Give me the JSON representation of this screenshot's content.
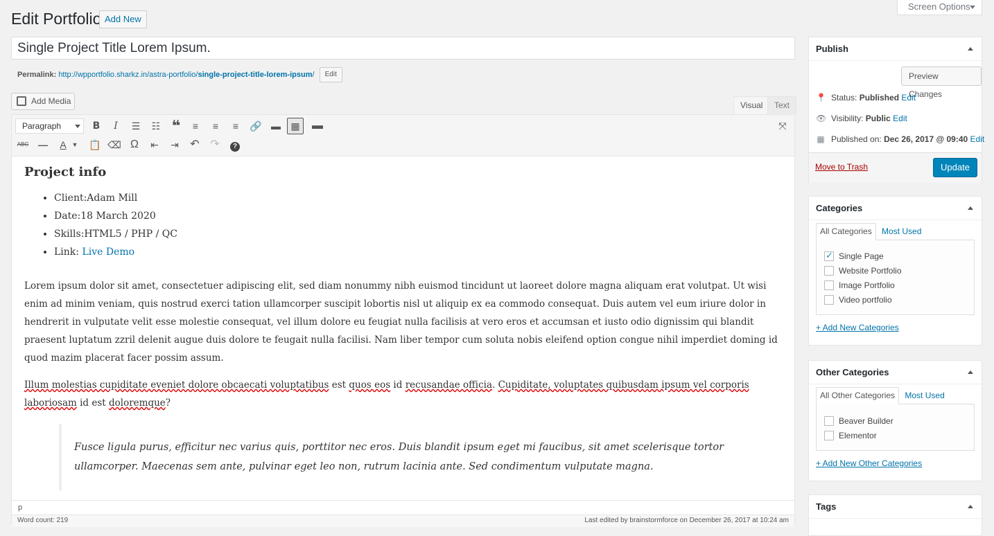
{
  "header": {
    "title": "Edit Portfolio",
    "add_new": "Add New",
    "screen_options": "Screen Options"
  },
  "post": {
    "title": "Single Project Title Lorem Ipsum.",
    "permalink_label": "Permalink:",
    "permalink_base": "http://wpportfolio.sharkz.in/astra-portfolio/",
    "permalink_slug": "single-project-title-lorem-ipsum",
    "permalink_end": "/",
    "permalink_edit": "Edit"
  },
  "editor": {
    "add_media": "Add Media",
    "tab_visual": "Visual",
    "tab_text": "Text",
    "format_select": "Paragraph",
    "path": "p",
    "word_count": "Word count: 219",
    "last_edited": "Last edited by brainstormforce on December 26, 2017 at 10:24 am",
    "toolbar_icons": [
      "bold-icon",
      "italic-icon",
      "bullet-list-icon",
      "numbered-list-icon",
      "blockquote-icon",
      "align-left-icon",
      "align-center-icon",
      "align-right-icon",
      "link-icon",
      "read-more-icon",
      "toolbar-toggle-icon",
      "more-icon",
      "fullscreen-icon",
      "strikethrough-icon",
      "horizontal-line-icon",
      "text-color-icon",
      "paste-text-icon",
      "clear-formatting-icon",
      "special-character-icon",
      "outdent-icon",
      "indent-icon",
      "undo-icon",
      "redo-icon",
      "help-icon"
    ]
  },
  "content": {
    "heading": "Project info",
    "items": [
      "Client:Adam Mill",
      "Date:18 March 2020",
      "Skills:HTML5 / PHP / QC"
    ],
    "link_label": "Link: ",
    "link_text": "Live Demo",
    "paragraph1": "Lorem ipsum dolor sit amet, consectetuer adipiscing elit, sed diam nonummy nibh euismod tincidunt ut laoreet dolore magna aliquam erat volutpat. Ut wisi enim ad minim veniam, quis nostrud exerci tation ullamcorper suscipit lobortis nisl ut aliquip ex ea commodo consequat. Duis autem vel eum iriure dolor in hendrerit in vulputate velit esse molestie consequat, vel illum dolore eu feugiat nulla facilisis at vero eros et accumsan et iusto odio dignissim qui blandit praesent luptatum zzril delenit augue duis dolore te feugait nulla facilisi. Nam liber tempor cum soluta nobis eleifend option congue nihil imperdiet doming id quod mazim placerat facer possim assum.",
    "paragraph2_parts": [
      {
        "t": "Illum molestias cupiditate eveniet dolore obcaecati voluptatibus",
        "sq": true
      },
      {
        "t": " est ",
        "sq": false
      },
      {
        "t": "quos eos",
        "sq": true
      },
      {
        "t": " id ",
        "sq": false
      },
      {
        "t": "recusandae officia",
        "sq": true
      },
      {
        "t": ". ",
        "sq": false
      },
      {
        "t": "Cupiditate, voluptates quibusdam ipsum vel corporis laboriosam",
        "sq": true
      },
      {
        "t": " id est ",
        "sq": false
      },
      {
        "t": "doloremque",
        "sq": true
      },
      {
        "t": "?",
        "sq": false
      }
    ],
    "quote": "Fusce ligula purus, efficitur nec varius quis, porttitor nec eros. Duis blandit ipsum eget mi faucibus, sit amet scelerisque tortor ullamcorper. Maecenas sem ante, pulvinar eget leo non, rutrum lacinia ante. Sed condimentum vulputate magna."
  },
  "publish": {
    "title": "Publish",
    "preview": "Preview Changes",
    "status_label": "Status: ",
    "status_value": "Published",
    "visibility_label": "Visibility: ",
    "visibility_value": "Public",
    "published_label": "Published on: ",
    "published_value": "Dec 26, 2017 @ 09:40",
    "edit": "Edit",
    "trash": "Move to Trash",
    "update": "Update"
  },
  "categories": {
    "title": "Categories",
    "tab_all": "All Categories",
    "tab_most": "Most Used",
    "items": [
      {
        "label": "Single Page",
        "checked": true
      },
      {
        "label": "Website Portfolio",
        "checked": false
      },
      {
        "label": "Image Portfolio",
        "checked": false
      },
      {
        "label": "Video portfolio",
        "checked": false
      }
    ],
    "add_new": "+ Add New Categories"
  },
  "other_categories": {
    "title": "Other Categories",
    "tab_all": "All Other Categories",
    "tab_most": "Most Used",
    "items": [
      {
        "label": "Beaver Builder",
        "checked": false
      },
      {
        "label": "Elementor",
        "checked": false
      }
    ],
    "add_new": "+ Add New Other Categories"
  },
  "tags": {
    "title": "Tags"
  }
}
